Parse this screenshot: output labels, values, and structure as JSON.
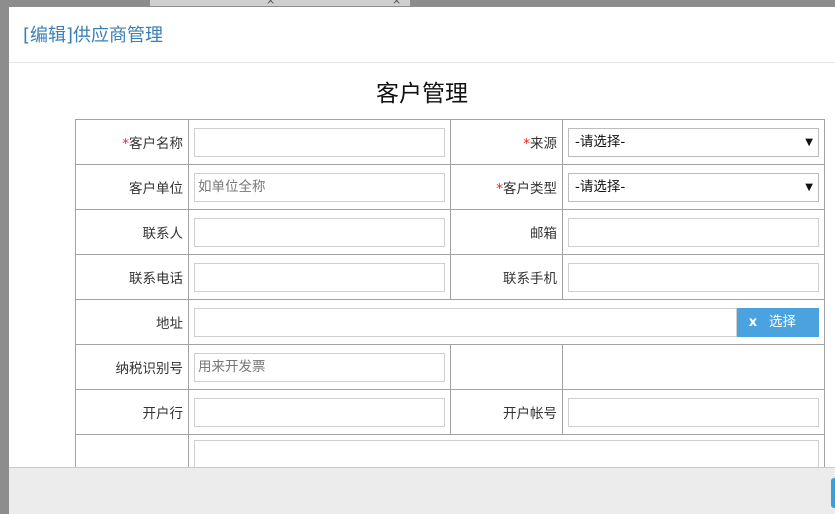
{
  "modal": {
    "title": "[编辑]供应商管理"
  },
  "form": {
    "title": "客户管理",
    "rows": [
      {
        "left_label": "客户名称",
        "left_required": true,
        "left_value": "",
        "right_label": "来源",
        "right_required": true,
        "right_type": "select",
        "right_value": "-请选择-"
      },
      {
        "left_label": "客户单位",
        "left_required": false,
        "left_placeholder": "如单位全称",
        "right_label": "客户类型",
        "right_required": true,
        "right_type": "select",
        "right_value": "-请选择-"
      },
      {
        "left_label": "联系人",
        "right_label": "邮箱"
      },
      {
        "left_label": "联系电话",
        "right_label": "联系手机"
      },
      {
        "left_label": "地址",
        "clear_label": "x",
        "pick_label": "选择"
      },
      {
        "left_label": "纳税识别号",
        "left_placeholder": "用来开发票"
      },
      {
        "left_label": "开户行",
        "right_label": "开户帐号"
      },
      {
        "left_label": ""
      }
    ],
    "required_mark": "*"
  },
  "icons": {
    "select_arrow": "▼",
    "bg_tab_close": "×"
  },
  "colors": {
    "title_blue": "#3a7fb5",
    "button_blue": "#4aa3df",
    "required_red": "#e22222"
  }
}
